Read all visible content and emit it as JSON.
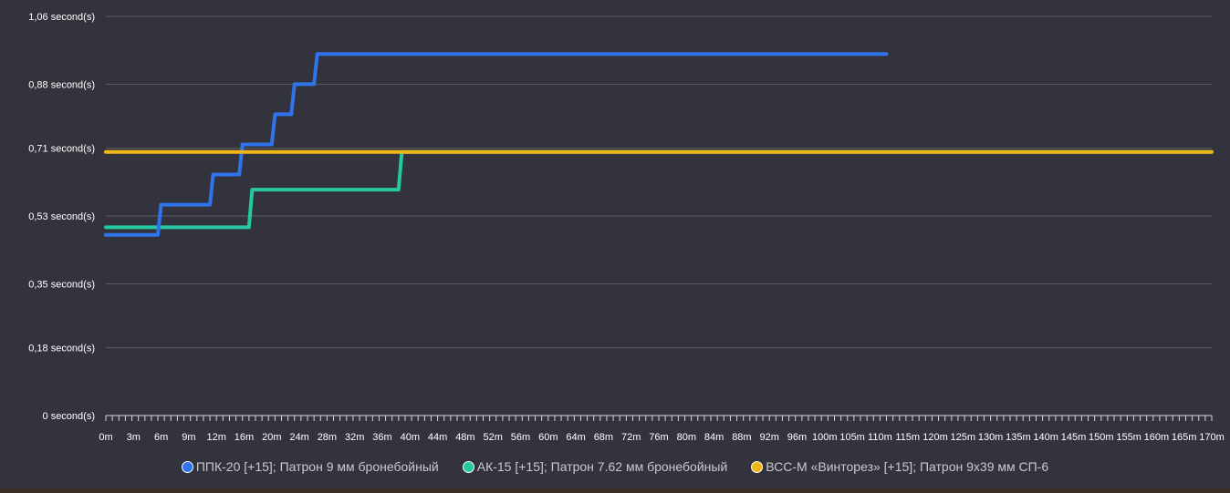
{
  "chart_data": {
    "type": "line",
    "title": "",
    "xlabel": "",
    "ylabel": "",
    "ylim": [
      0,
      1.06
    ],
    "xlim": [
      0,
      170
    ],
    "y_ticks": [
      0,
      0.18,
      0.35,
      0.53,
      0.71,
      0.88,
      1.06
    ],
    "y_tick_labels": [
      "0 second(s)",
      "0,18 second(s)",
      "0,35 second(s)",
      "0,53 second(s)",
      "0,71 second(s)",
      "0,88 second(s)",
      "1,06 second(s)"
    ],
    "x_tick_labels": [
      "0m",
      "3m",
      "6m",
      "9m",
      "12m",
      "16m",
      "20m",
      "24m",
      "28m",
      "32m",
      "36m",
      "40m",
      "44m",
      "48m",
      "52m",
      "56m",
      "60m",
      "64m",
      "68m",
      "72m",
      "76m",
      "80m",
      "84m",
      "88m",
      "92m",
      "96m",
      "100m",
      "105m",
      "110m",
      "115m",
      "120m",
      "125m",
      "130m",
      "135m",
      "140m",
      "145m",
      "150m",
      "155m",
      "160m",
      "165m",
      "170m"
    ],
    "grid": true,
    "legend_position": "bottom",
    "series": [
      {
        "name": "ППК-20 [+15]; Патрон 9 мм бронебойный",
        "color": "#2f74ec",
        "points": [
          [
            0,
            0.48
          ],
          [
            8,
            0.48
          ],
          [
            8.5,
            0.56
          ],
          [
            16,
            0.56
          ],
          [
            16.5,
            0.64
          ],
          [
            20.5,
            0.64
          ],
          [
            21,
            0.72
          ],
          [
            25.5,
            0.72
          ],
          [
            26,
            0.8
          ],
          [
            28.5,
            0.8
          ],
          [
            29,
            0.88
          ],
          [
            32,
            0.88
          ],
          [
            32.5,
            0.96
          ],
          [
            120,
            0.96
          ]
        ]
      },
      {
        "name": "АК-15 [+15]; Патрон 7.62 мм бронебойный",
        "color": "#24c9a1",
        "points": [
          [
            0,
            0.5
          ],
          [
            22,
            0.5
          ],
          [
            22.5,
            0.6
          ],
          [
            45,
            0.6
          ],
          [
            45.5,
            0.7
          ],
          [
            170,
            0.7
          ]
        ]
      },
      {
        "name": "ВСС-М «Винторез» [+15]; Патрон 9х39 мм СП-6",
        "color": "#f0b618",
        "points": [
          [
            0,
            0.7
          ],
          [
            170,
            0.7
          ]
        ]
      }
    ]
  }
}
